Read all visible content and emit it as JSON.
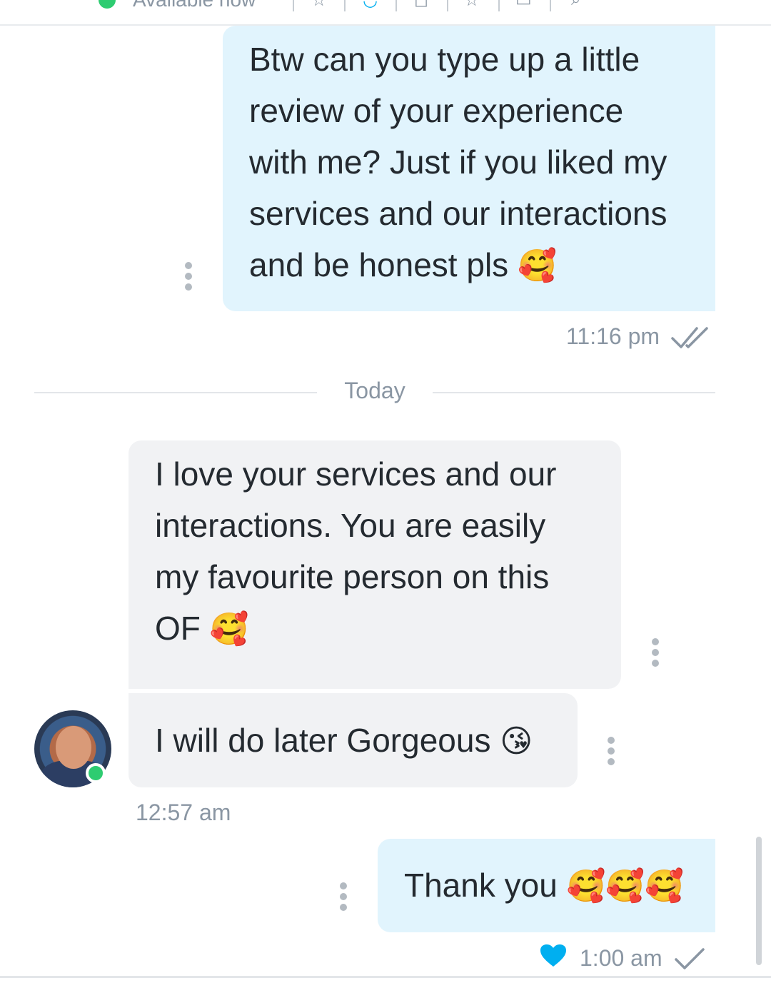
{
  "top_bar": {
    "status_text": "Available now"
  },
  "messages": [
    {
      "lines": [
        "Btw can you type up a little",
        "review of your experience",
        "with me? Just if you liked my",
        "services and our interactions",
        "and be honest pls"
      ],
      "emoji": "🥰",
      "time": "11:16 pm"
    },
    {
      "lines": [
        "I love your services and our",
        "interactions. You are easily",
        "my favourite person on this",
        "OF"
      ],
      "emoji": "🥰"
    },
    {
      "lines": [
        "I will do later Gorgeous"
      ],
      "emoji": "😘",
      "time": "12:57 am"
    },
    {
      "lines": [
        "Thank you"
      ],
      "emoji": "🥰🥰🥰",
      "time": "1:00 am"
    }
  ],
  "date_separator": "Today",
  "icons": {
    "options": "more-vertical-icon",
    "read_receipt": "double-check-icon",
    "sent_receipt": "check-icon",
    "liked": "heart-icon",
    "online": "online-status-icon"
  },
  "colors": {
    "outgoing_bubble": "#e1f4fd",
    "incoming_bubble": "#f1f2f4",
    "heart": "#00aff0",
    "online": "#2ecc71",
    "meta_text": "#8a96a3"
  }
}
